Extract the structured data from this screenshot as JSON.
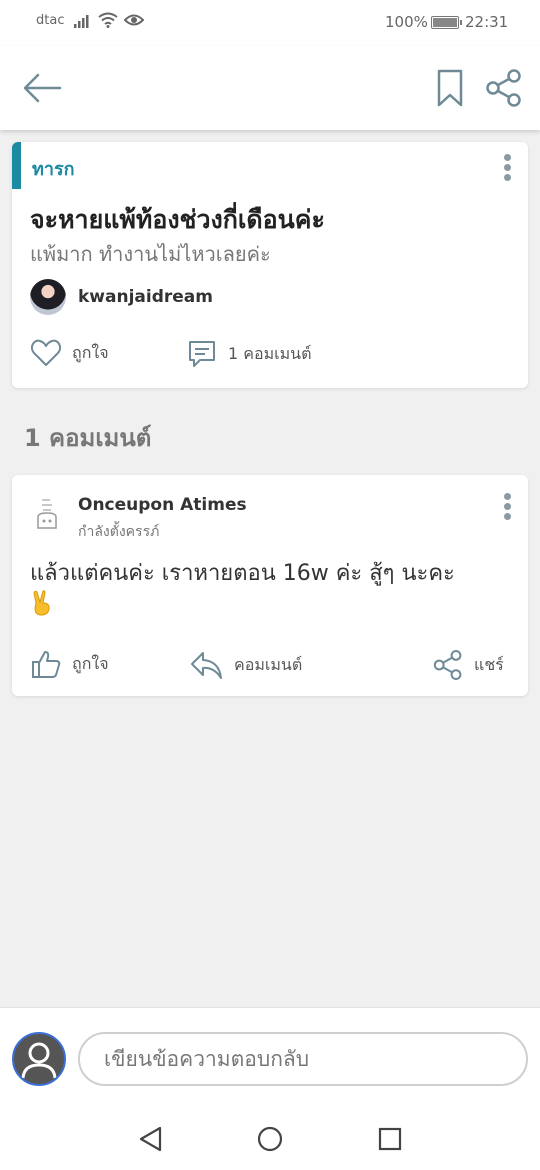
{
  "status_bar": {
    "carrier": "dtac",
    "battery": "100%",
    "time": "22:31"
  },
  "header": {
    "icons": [
      "back-arrow-icon",
      "bookmark-icon",
      "share-icon"
    ]
  },
  "post": {
    "tag": "ทารก",
    "title": "จะหายแพ้ท้องช่วงกี่เดือนค่ะ",
    "subtitle": "แพ้มาก ทำงานไม่ไหวเลยค่ะ",
    "author": "kwanjaidream",
    "like_label": "ถูกใจ",
    "comment_label": "1 คอมเมนต์"
  },
  "comments_section": {
    "title": "1 คอมเมนต์"
  },
  "comments": [
    {
      "name": "Onceupon Atimes",
      "status": "กำลังตั้งครรภ์",
      "text": "แล้วแต่คนค่ะ เราหายตอน 16w ค่ะ สู้ๆ นะคะ",
      "like_label": "ถูกใจ",
      "reply_label": "คอมเมนต์",
      "share_label": "แชร์"
    }
  ],
  "reply": {
    "placeholder": "เขียนข้อความตอบกลับ"
  },
  "colors": {
    "accent": "#1b8aa3",
    "icon": "#6f8a96"
  }
}
